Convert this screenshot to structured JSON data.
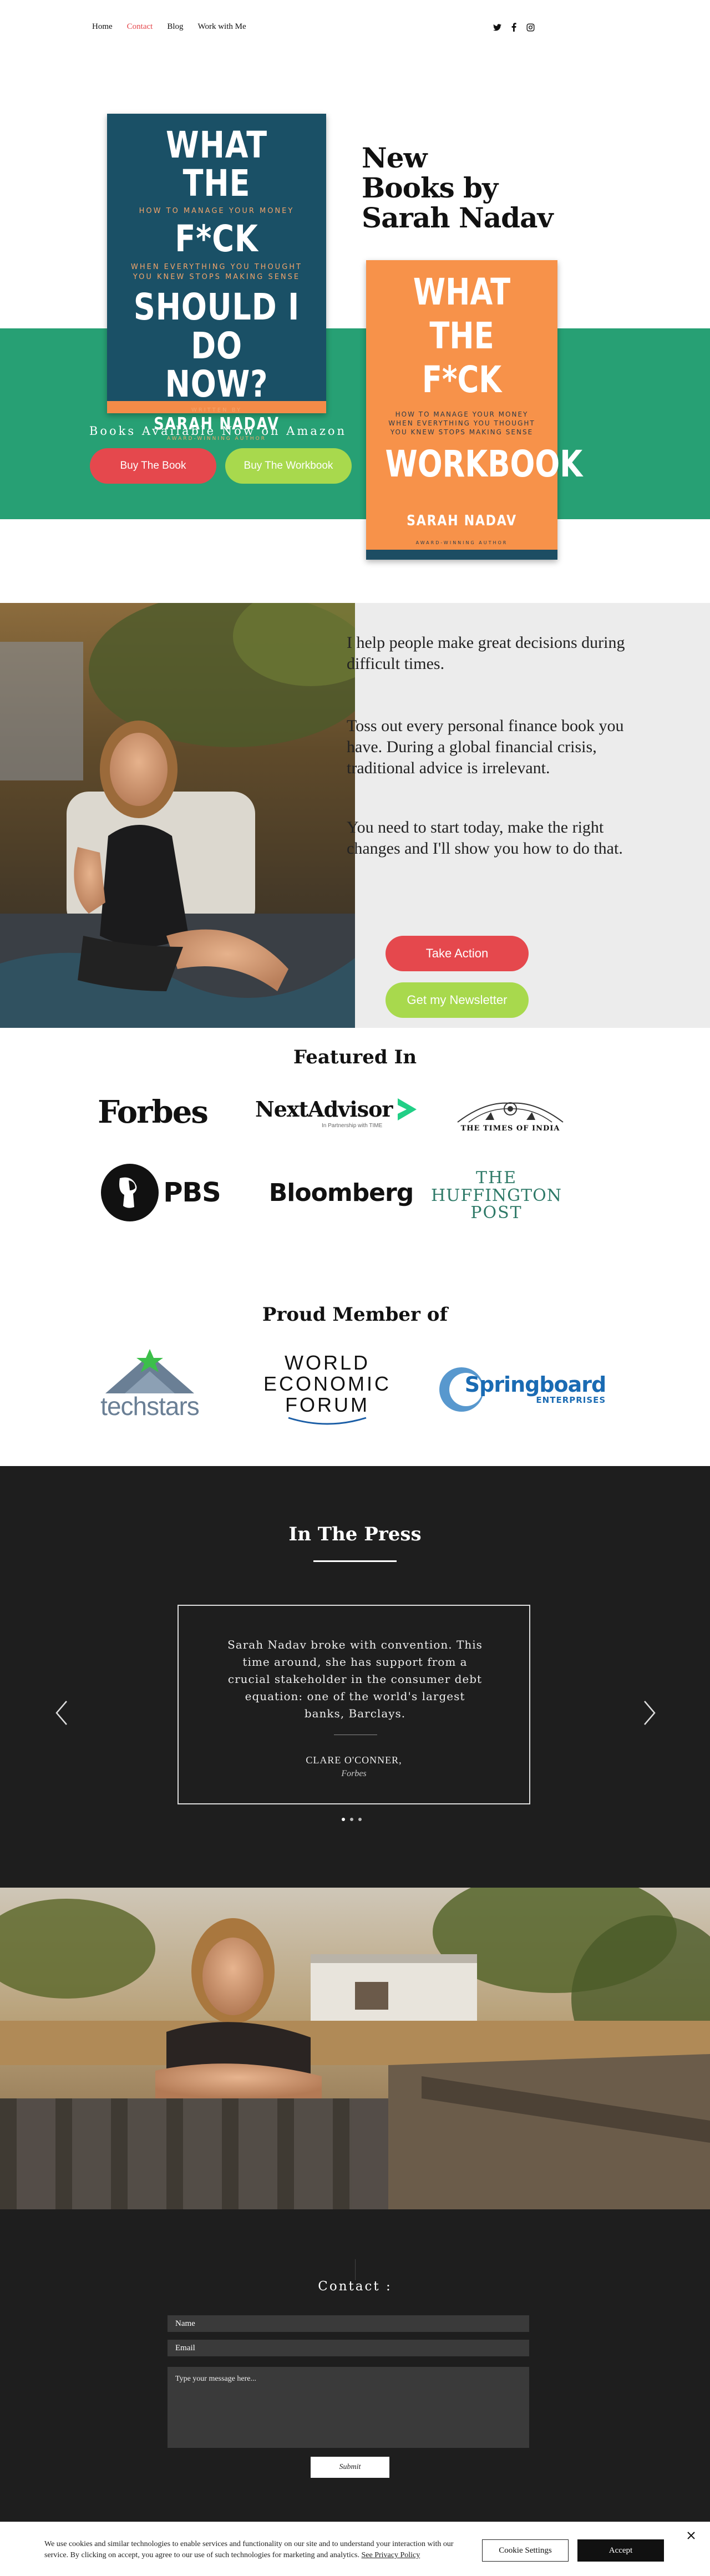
{
  "nav": {
    "links": [
      "Home",
      "Contact",
      "Blog",
      "Work with Me"
    ],
    "active": "Contact",
    "socials": [
      "twitter-icon",
      "facebook-icon",
      "instagram-icon"
    ]
  },
  "hero": {
    "title_line1": "New",
    "title_line2": "Books by",
    "title_line3": "Sarah Nadav",
    "available": "Books Available Now on Amazon",
    "btn_book": "Buy The Book",
    "btn_workbook": "Buy The Workbook",
    "colors": {
      "band": "#27a074",
      "red": "#e5484d",
      "green": "#a8d94d"
    }
  },
  "book1": {
    "line1": "WHAT THE",
    "sub1": "HOW TO MANAGE YOUR MONEY",
    "line2": "F*CK",
    "sub2": "WHEN EVERYTHING YOU THOUGHT",
    "sub3": "YOU KNEW STOPS MAKING SENSE",
    "line3": "SHOULD I DO",
    "line4": "NOW?",
    "written": "WRITTEN BY",
    "author": "SARAH NADAV",
    "award": "AWARD-WINNING AUTHOR"
  },
  "book2": {
    "line1": "WHAT THE",
    "line2": "F*CK",
    "sub1": "HOW TO MANAGE YOUR MONEY",
    "sub2": "WHEN EVERYTHING YOU THOUGHT",
    "sub3": "YOU KNEW STOPS MAKING SENSE",
    "line3": "WORKBOOK",
    "author": "SARAH NADAV",
    "award": "AWARD-WINNING AUTHOR"
  },
  "about": {
    "p1": "I help people make great decisions during difficult times.",
    "p2": "Toss out every personal finance book you have. During a global financial crisis, traditional advice is irrelevant.",
    "p3": "You need to start today, make the right changes and I'll show you how to do that.",
    "btn_action": "Take Action",
    "btn_news": "Get my Newsletter"
  },
  "featured": {
    "title": "Featured In",
    "forbes": "Forbes",
    "nextadvisor": "NextAdvisor",
    "nextadvisor_sub": "In Partnership with TIME",
    "toi": "THE TIMES OF INDIA",
    "pbs": "PBS",
    "bloomberg": "Bloomberg",
    "huff1": "THE",
    "huff2": "HUFFINGTON",
    "huff3": "POST"
  },
  "member": {
    "title": "Proud Member of",
    "techstars": "techstars",
    "wef1": "WORLD",
    "wef2": "ECONOMIC",
    "wef3": "FORUM",
    "springboard": "Springboard",
    "springboard_sub": "ENTERPRISES"
  },
  "press": {
    "title": "In The Press",
    "quote": "Sarah Nadav broke with convention. This time around, she has support from a crucial stakeholder in the consumer debt equation: one of the world's largest banks, Barclays.",
    "name": "CLARE O'CONNER,",
    "source": "Forbes"
  },
  "contact": {
    "title": "Contact :",
    "name_placeholder": "Name",
    "email_placeholder": "Email",
    "message_placeholder": "Type your message here...",
    "submit": "Submit"
  },
  "cookie": {
    "text": "We use cookies and similar technologies to enable services and functionality on our site and to understand your interaction with our service. By clicking on accept, you agree to our use of such technologies for marketing and analytics.",
    "link": "See Privacy Policy",
    "settings": "Cookie Settings",
    "accept": "Accept"
  }
}
